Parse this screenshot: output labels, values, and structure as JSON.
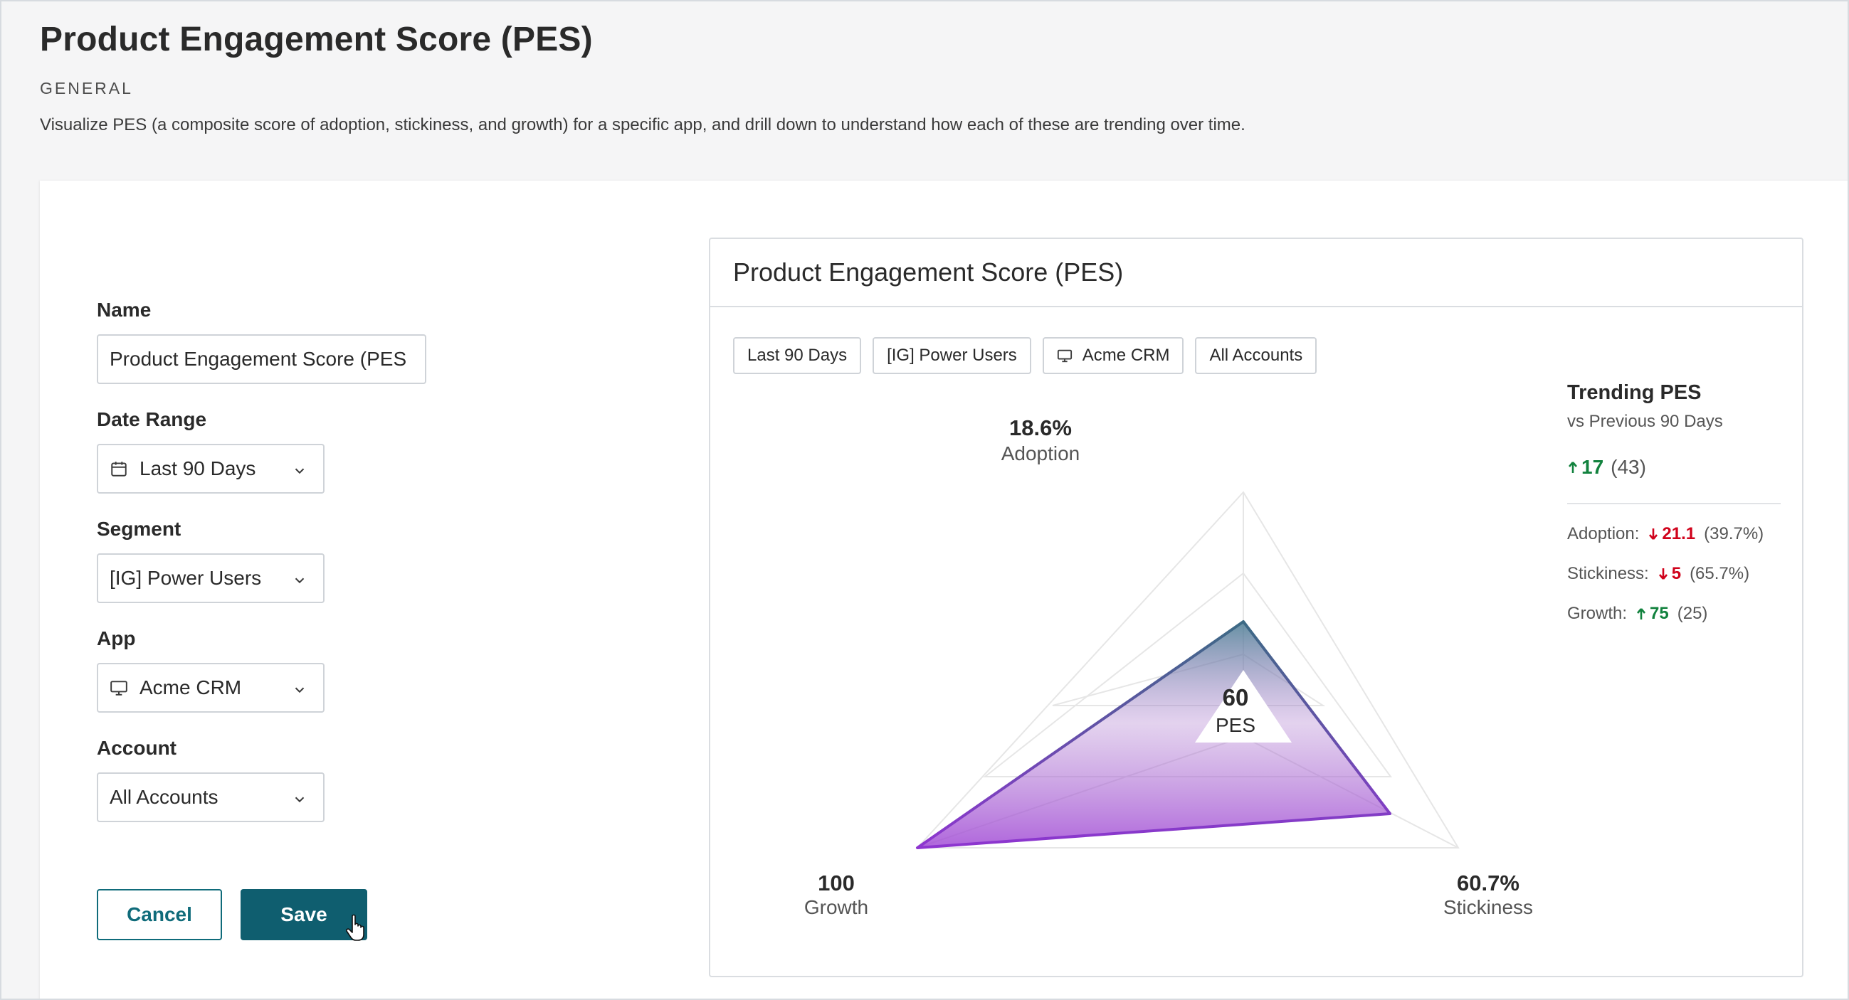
{
  "header": {
    "title": "Product Engagement Score (PES)",
    "category": "GENERAL",
    "description": "Visualize PES (a composite score of adoption, stickiness, and growth) for a specific app, and drill down to understand how each of these are trending over time."
  },
  "form": {
    "name_label": "Name",
    "name_value": "Product Engagement Score (PES",
    "date_range_label": "Date Range",
    "date_range_value": "Last 90 Days",
    "segment_label": "Segment",
    "segment_value": "[IG] Power Users",
    "app_label": "App",
    "app_value": "Acme CRM",
    "account_label": "Account",
    "account_value": "All Accounts",
    "cancel_label": "Cancel",
    "save_label": "Save"
  },
  "preview": {
    "title": "Product Engagement Score (PES)",
    "chips": [
      "Last 90 Days",
      "[IG] Power Users",
      "Acme CRM",
      "All Accounts"
    ],
    "adoption_value": "18.6%",
    "adoption_label": "Adoption",
    "growth_value": "100",
    "growth_label": "Growth",
    "stickiness_value": "60.7%",
    "stickiness_label": "Stickiness",
    "pes_value": "60",
    "pes_label": "PES"
  },
  "trending": {
    "title": "Trending PES",
    "subtitle": "vs Previous 90 Days",
    "pes_delta": "17",
    "pes_previous": "(43)",
    "adoption_label": "Adoption:",
    "adoption_delta": "21.1",
    "adoption_previous": "(39.7%)",
    "stickiness_label": "Stickiness:",
    "stickiness_delta": "5",
    "stickiness_previous": "(65.7%)",
    "growth_label": "Growth:",
    "growth_delta": "75",
    "growth_previous": "(25)"
  },
  "colors": {
    "primary": "#0f5e6f",
    "up": "#12823e",
    "down": "#d0021b",
    "radar_top": "#3f6f86",
    "radar_bottom": "#9b3fd0"
  },
  "icons": {
    "date_range": "calendar-icon",
    "app": "monitor-icon",
    "dropdown": "chevron-down-icon"
  }
}
